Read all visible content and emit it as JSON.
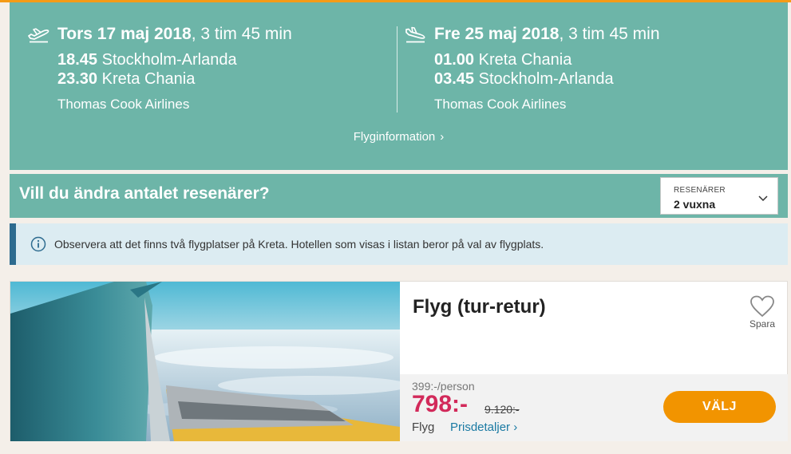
{
  "colors": {
    "accent": "#f29400",
    "panel": "#6db5a8",
    "price": "#d2295a",
    "link": "#1a7aa3",
    "notice_bg": "#dcecf2",
    "notice_bar": "#2d6b8f"
  },
  "flight": {
    "outbound": {
      "icon": "plane-takeoff-icon",
      "date": "Tors 17 maj 2018",
      "duration": ", 3 tim 45 min",
      "dep_time": "18.45",
      "dep_place": "Stockholm-Arlanda",
      "arr_time": "23.30",
      "arr_place": "Kreta Chania",
      "airline": "Thomas Cook Airlines"
    },
    "return": {
      "icon": "plane-landing-icon",
      "date": "Fre 25 maj 2018",
      "duration": ", 3 tim 45 min",
      "dep_time": "01.00",
      "dep_place": "Kreta Chania",
      "arr_time": "03.45",
      "arr_place": "Stockholm-Arlanda",
      "airline": "Thomas Cook Airlines"
    },
    "info_link": "Flyginformation",
    "info_chevron": "›"
  },
  "passengers": {
    "title": "Vill du ändra antalet resenärer?",
    "select_label": "RESENÄRER",
    "select_value": "2 vuxna"
  },
  "notice": {
    "text": "Observera att det finns två flygplatser på Kreta. Hotellen som visas i listan beror på val av flygplats."
  },
  "offer": {
    "title": "Flyg (tur-retur)",
    "save_label": "Spara",
    "per_person": "399:-/person",
    "price": "798:-",
    "old_price": "9.120:-",
    "type_label": "Flyg",
    "details_link": "Prisdetaljer",
    "details_chevron": "›",
    "select_button": "VÄLJ"
  }
}
